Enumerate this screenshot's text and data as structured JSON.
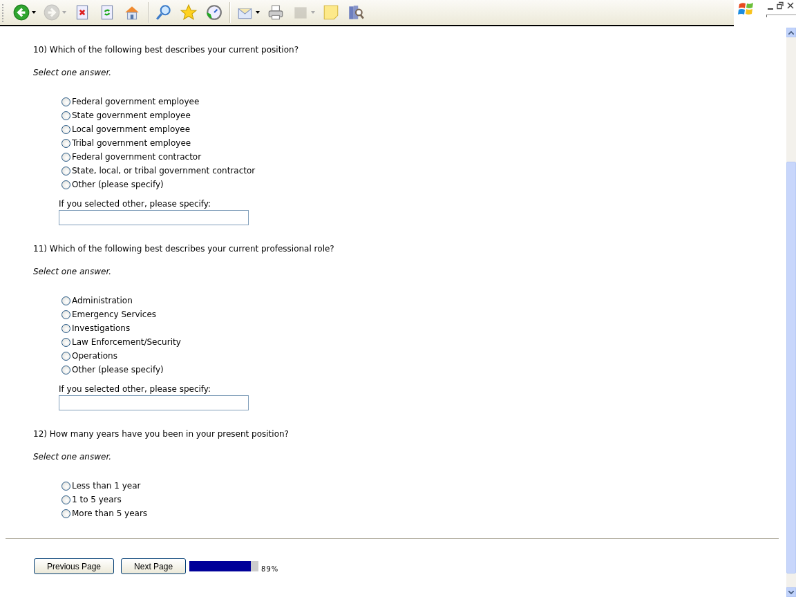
{
  "toolbar": {
    "tools": [
      {
        "kind": "back",
        "dropdown": true,
        "disabled": false
      },
      {
        "kind": "forward",
        "dropdown": true,
        "disabled": true
      },
      {
        "kind": "stop",
        "dropdown": false,
        "disabled": false
      },
      {
        "kind": "refresh",
        "dropdown": false,
        "disabled": false
      },
      {
        "kind": "home",
        "dropdown": false,
        "disabled": false
      },
      {
        "kind": "separator"
      },
      {
        "kind": "search",
        "dropdown": false,
        "disabled": false
      },
      {
        "kind": "favorites",
        "dropdown": false,
        "disabled": false
      },
      {
        "kind": "history",
        "dropdown": false,
        "disabled": false
      },
      {
        "kind": "separator"
      },
      {
        "kind": "mail",
        "dropdown": true,
        "disabled": false
      },
      {
        "kind": "print",
        "dropdown": false,
        "disabled": false
      },
      {
        "kind": "blank",
        "dropdown": true,
        "disabled": true
      },
      {
        "kind": "note",
        "dropdown": false,
        "disabled": false
      },
      {
        "kind": "research",
        "dropdown": false,
        "disabled": false
      }
    ]
  },
  "questions": [
    {
      "title": "10) Which of the following best describes your current position?",
      "instruction": "Select one answer.",
      "options": [
        {
          "label": "Federal government employee",
          "selected": false
        },
        {
          "label": "State government employee",
          "selected": false
        },
        {
          "label": "Local government employee",
          "selected": false
        },
        {
          "label": "Tribal government employee",
          "selected": false
        },
        {
          "label": "Federal government contractor",
          "selected": false
        },
        {
          "label": "State, local, or tribal government contractor",
          "selected": false
        },
        {
          "label": "Other (please specify)",
          "selected": false
        }
      ],
      "other": {
        "label": "If you selected other, please specify:"
      }
    },
    {
      "title": "11) Which of the following best describes your current professional role?",
      "instruction": "Select one answer.",
      "options": [
        {
          "label": "Administration",
          "selected": false
        },
        {
          "label": "Emergency Services",
          "selected": false
        },
        {
          "label": "Investigations",
          "selected": false
        },
        {
          "label": "Law Enforcement/Security",
          "selected": false
        },
        {
          "label": "Operations",
          "selected": false
        },
        {
          "label": "Other (please specify)",
          "selected": false
        }
      ],
      "other": {
        "label": "If you selected other, please specify:"
      }
    },
    {
      "title": "12) How many years have you been in your present position?",
      "instruction": "Select one answer.",
      "options": [
        {
          "label": "Less than 1 year",
          "selected": false
        },
        {
          "label": "1 to 5 years",
          "selected": false
        },
        {
          "label": "More than 5 years",
          "selected": false
        }
      ]
    }
  ],
  "footer": {
    "buttons": [
      "Previous Page",
      "Next Page"
    ],
    "progress": {
      "level": 0.89,
      "reading": "89%"
    }
  }
}
